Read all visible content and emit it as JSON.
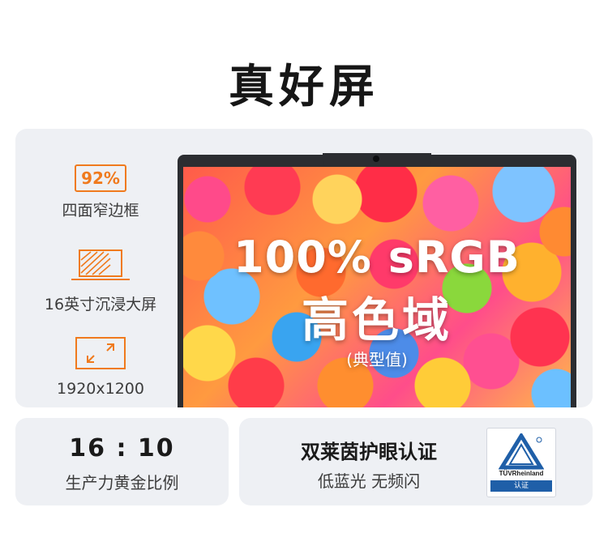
{
  "page": {
    "title": "真好屏"
  },
  "features": [
    {
      "badge": "92%",
      "label": "四面窄边框",
      "icon": "narrow-bezel-icon"
    },
    {
      "label": "16英寸沉浸大屏",
      "icon": "screen-size-icon"
    },
    {
      "label": "1920x1200",
      "icon": "resolution-expand-icon"
    }
  ],
  "screen": {
    "headline": "100% sRGB",
    "subheadline": "高色域",
    "note": "(典型值)"
  },
  "ratio": {
    "value": "16 : 10",
    "label": "生产力黄金比例"
  },
  "eye_care": {
    "title": "双莱茵护眼认证",
    "subtitle": "低蓝光 无频闪",
    "badge_name": "TÜVRheinland",
    "badge_band": "认证"
  },
  "colors": {
    "accent": "#f07a1d",
    "card_bg": "#eef0f4",
    "tuv_blue": "#1f5fa8"
  }
}
